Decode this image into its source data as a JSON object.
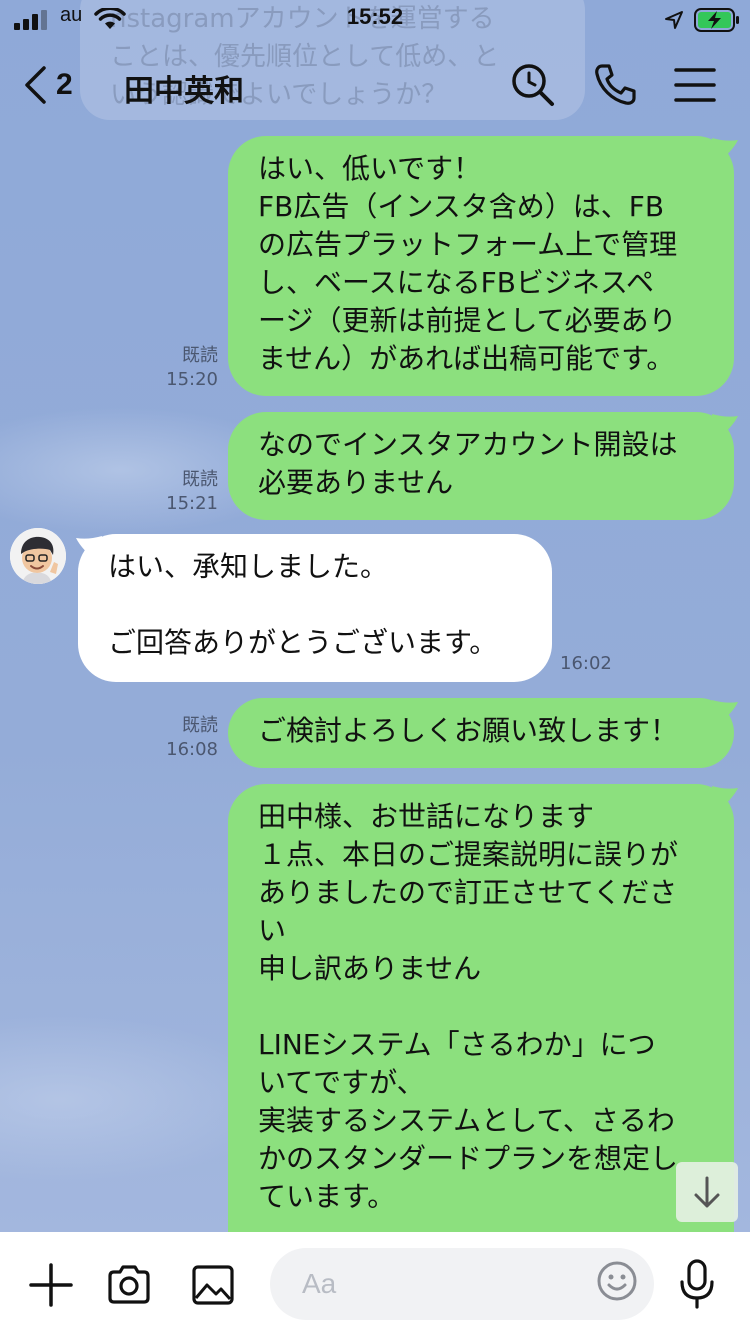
{
  "status_bar": {
    "carrier": "au",
    "time": "15:52"
  },
  "faded_message": "nstagramアカウントを運営する\nことは、優先順位として低め、と\nいう認識でよいでしょうか？",
  "header": {
    "unread_count": "2",
    "title": "田中英和"
  },
  "messages": [
    {
      "direction": "out",
      "text": "はい、低いです！\nFB広告（インスタ含め）は、FB\nの広告プラットフォーム上で管理\nし、ベースになるFBビジネスペ\nージ（更新は前提として必要あり\nません）があれば出稿可能です。",
      "read": "既読",
      "time": "15:20"
    },
    {
      "direction": "out",
      "text": "なのでインスタアカウント開設は\n必要ありません",
      "read": "既読",
      "time": "15:21"
    },
    {
      "direction": "in",
      "text": "はい、承知しました。\n\nご回答ありがとうございます。",
      "time": "16:02"
    },
    {
      "direction": "out",
      "text": "ご検討よろしくお願い致します！",
      "read": "既読",
      "time": "16:08"
    },
    {
      "direction": "out",
      "text": "田中様、お世話になります\n１点、本日のご提案説明に誤りが\nありましたので訂正させてくださ\nい\n申し訳ありません\n\nLINEシステム「さるわか」につ\nいてですが、\n実装するシステムとして、さるわ\nかのスタンダードプランを想定し\nています。"
    }
  ],
  "input": {
    "placeholder": "Aa"
  },
  "colors": {
    "chat_background": "#8fa8d6",
    "outgoing_bubble": "#8ce07e",
    "incoming_bubble": "#ffffff",
    "battery_charging": "#34c759"
  },
  "icons": [
    "signal-icon",
    "wifi-icon",
    "location-icon",
    "battery-icon",
    "back-icon",
    "search-icon",
    "phone-icon",
    "menu-icon",
    "plus-icon",
    "camera-icon",
    "image-icon",
    "emoji-icon",
    "mic-icon",
    "arrow-down-icon"
  ]
}
